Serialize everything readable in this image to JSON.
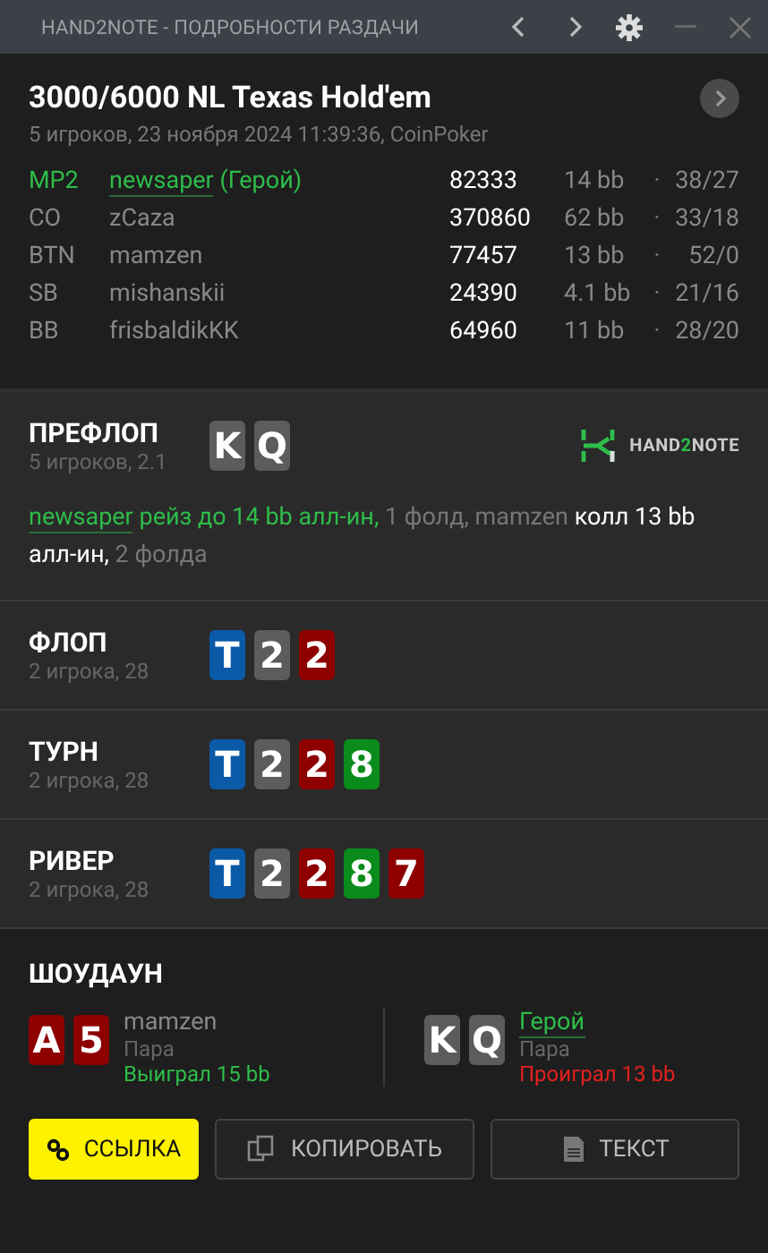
{
  "window": {
    "title": "HAND2NOTE - ПОДРОБНОСТИ РАЗДАЧИ"
  },
  "hand": {
    "title": "3000/6000 NL Texas Hold'em",
    "subtitle": "5 игроков, 23 ноября 2024 11:39:36, CoinPoker"
  },
  "players": [
    {
      "position": "MP2",
      "name": "newsaper",
      "hero_label": "(Герой)",
      "hero": true,
      "stack": "82333",
      "bb": "14 bb",
      "separator": "·",
      "stats": "38/27"
    },
    {
      "position": "CO",
      "name": "zCaza",
      "hero": false,
      "stack": "370860",
      "bb": "62 bb",
      "separator": "·",
      "stats": "33/18"
    },
    {
      "position": "BTN",
      "name": "mamzen",
      "hero": false,
      "stack": "77457",
      "bb": "13 bb",
      "separator": "·",
      "stats": "52/0"
    },
    {
      "position": "SB",
      "name": "mishanskii",
      "hero": false,
      "stack": "24390",
      "bb": "4.1 bb",
      "separator": "·",
      "stats": "21/16"
    },
    {
      "position": "BB",
      "name": "frisbaldikKK",
      "hero": false,
      "stack": "64960",
      "bb": "11 bb",
      "separator": "·",
      "stats": "28/20"
    }
  ],
  "streets": [
    {
      "name": "ПРЕФЛОП",
      "info": "5 игроков, 2.1",
      "cards": [
        {
          "rank": "K",
          "color": "#5c5c5c"
        },
        {
          "rank": "Q",
          "color": "#5c5c5c"
        }
      ],
      "logo": [
        {
          "text": "HAND",
          "accent": false
        },
        {
          "text": "2",
          "accent": true
        },
        {
          "text": "NOTE",
          "accent": false
        }
      ],
      "actions": [
        {
          "text": "newsaper",
          "kind": "hero-name"
        },
        {
          "text": " рейз до 14 bb алл-ин,",
          "kind": "hero-action"
        },
        {
          "text": " 1 фолд, mamzen",
          "kind": "info"
        },
        {
          "text": " колл 13 bb алл-ин,",
          "kind": "action"
        },
        {
          "text": " 2 фолда",
          "kind": "info"
        }
      ]
    },
    {
      "name": "ФЛОП",
      "info": "2 игрока, 28",
      "cards": [
        {
          "rank": "T",
          "color": "#0b5aa8"
        },
        {
          "rank": "2",
          "color": "#5c5c5c"
        },
        {
          "rank": "2",
          "color": "#8e0000"
        }
      ]
    },
    {
      "name": "ТУРН",
      "info": "2 игрока, 28",
      "cards": [
        {
          "rank": "T",
          "color": "#0b5aa8"
        },
        {
          "rank": "2",
          "color": "#5c5c5c"
        },
        {
          "rank": "2",
          "color": "#8e0000"
        },
        {
          "rank": "8",
          "color": "#0a8c1c"
        }
      ]
    },
    {
      "name": "РИВЕР",
      "info": "2 игрока, 28",
      "cards": [
        {
          "rank": "T",
          "color": "#0b5aa8"
        },
        {
          "rank": "2",
          "color": "#5c5c5c"
        },
        {
          "rank": "2",
          "color": "#8e0000"
        },
        {
          "rank": "8",
          "color": "#0a8c1c"
        },
        {
          "rank": "7",
          "color": "#8e0000"
        }
      ]
    }
  ],
  "showdown": {
    "title": "ШОУДАУН",
    "hands": [
      {
        "name": "mamzen",
        "hero": false,
        "combo": "Пара",
        "result": "Выиграл 15 bb",
        "won": true,
        "cards": [
          {
            "rank": "A",
            "color": "#8e0000"
          },
          {
            "rank": "5",
            "color": "#8e0000"
          }
        ]
      },
      {
        "name": "Герой",
        "hero": true,
        "combo": "Пара",
        "result": "Проиграл 13 bb",
        "won": false,
        "cards": [
          {
            "rank": "K",
            "color": "#5c5c5c"
          },
          {
            "rank": "Q",
            "color": "#5c5c5c"
          }
        ]
      }
    ]
  },
  "buttons": [
    {
      "label": "ССЫЛКА",
      "kind": "link",
      "primary": true
    },
    {
      "label": "КОПИРОВАТЬ",
      "kind": "copy",
      "primary": false
    },
    {
      "label": "ТЕКСТ",
      "kind": "text",
      "primary": false
    }
  ]
}
